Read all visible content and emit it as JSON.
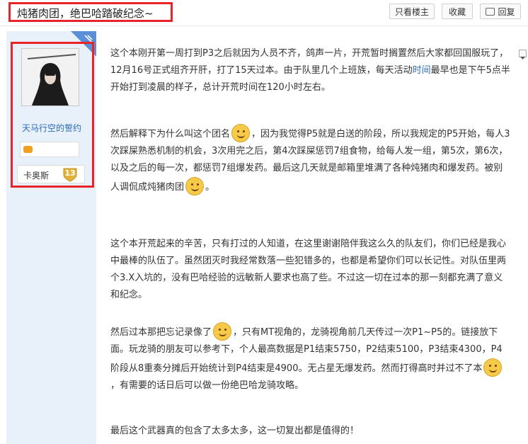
{
  "header": {
    "title": "炖猪肉团，绝巴哈踏破纪念~",
    "buttons": {
      "only_author": "只看楼主",
      "favorite": "收藏",
      "reply": "回复"
    }
  },
  "user": {
    "name": "天马行空的誓约",
    "rank_title": "卡奥斯",
    "rank_level": "13"
  },
  "post": {
    "p1": {
      "a": "这个本刚开第一周打到P3之后就因为人员不齐，鸽声一片，开荒暂时搁置然后大家都回国服玩了，12月16号正式组齐开肝，打了15天过本。由于队里几个上班族，每天活动",
      "link": "时间",
      "b": "最早也是下午5点半开始打到凌晨的样子，总计开荒时间在120小时左右。"
    },
    "p2": {
      "a": "然后解释下为什么叫这个团名",
      "b": "，因为我觉得P5就是白送的阶段，所以我规定的P5开始，每人3次踩屎熟悉机制的机会，3次用完之后，第4次踩屎惩罚7组食物，给每人发一组，第5次，第6次，以及之后的每一次，都惩罚7组爆发药。最后这几天就是邮箱里堆满了各种炖猪肉和爆发药。被别人调侃成炖猪肉团"
    },
    "p3": "这个本开荒起来的辛苦，只有打过的人知道，在这里谢谢陪伴我这么久的队友们，你们已经是我心中最棒的队伍了。虽然团灭时我经常数落一些犯错多的，也都是希望你们可以长记性。对队伍里两个3.X入坑的，没有巴哈经验的远敏新人要求也高了些。不过这一切在过本的那一刻都充满了意义和纪念。",
    "p4": {
      "a": "然后过本那把忘记录像了",
      "b": "，只有MT视角的，龙骑视角前几天传过一次P1~P5的。链接放下面。玩龙骑的朋友可以参考下，个人最高数据是P1结束5750，P2结束5100，P3结束4300，P4阶段从8重奏分摊后开始统计到P4结束是4900。无占星无爆发药。然而打得高时并过不了本",
      "c": "，有需要的话日后可以做一份绝巴哈龙骑攻略。"
    },
    "p5": "最后这个武器真的包含了太多太多，这一切复出都是值得的！"
  },
  "colors": {
    "highlight_border": "#e8232a",
    "sidebar_bg": "#e8f0fa",
    "username": "#2b6bb5"
  },
  "icons": [
    "reply-icon",
    "medal-icon",
    "rank-badge-icon",
    "emoji-smile-icon",
    "emoji-laugh-icon",
    "emoji-cry-icon",
    "emoji-shy-icon",
    "post-menu-icon"
  ]
}
